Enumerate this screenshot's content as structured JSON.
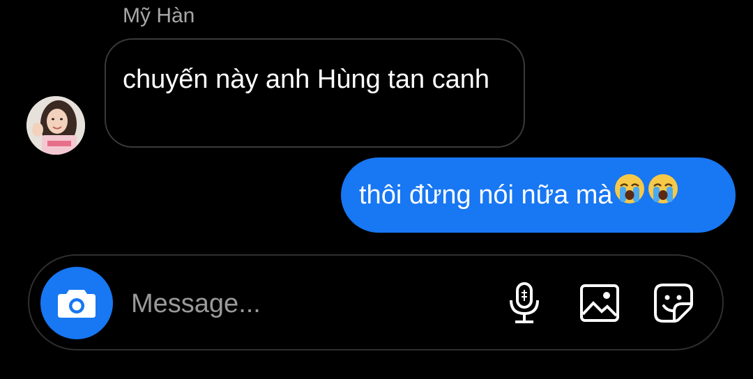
{
  "conversation": {
    "sender_name": "Mỹ Hàn",
    "incoming_message": "chuyến này anh Hùng tan canh",
    "outgoing_message": "thôi đừng nói nữa mà",
    "outgoing_emojis": [
      "loudly-crying-face",
      "loudly-crying-face"
    ]
  },
  "composer": {
    "placeholder": "Message..."
  },
  "colors": {
    "accent": "#1877f2",
    "background": "#000000",
    "incoming_border": "#3a3a3a"
  },
  "icons": {
    "camera": "camera-icon",
    "mic": "microphone-icon",
    "gallery": "image-icon",
    "sticker": "sticker-icon"
  }
}
